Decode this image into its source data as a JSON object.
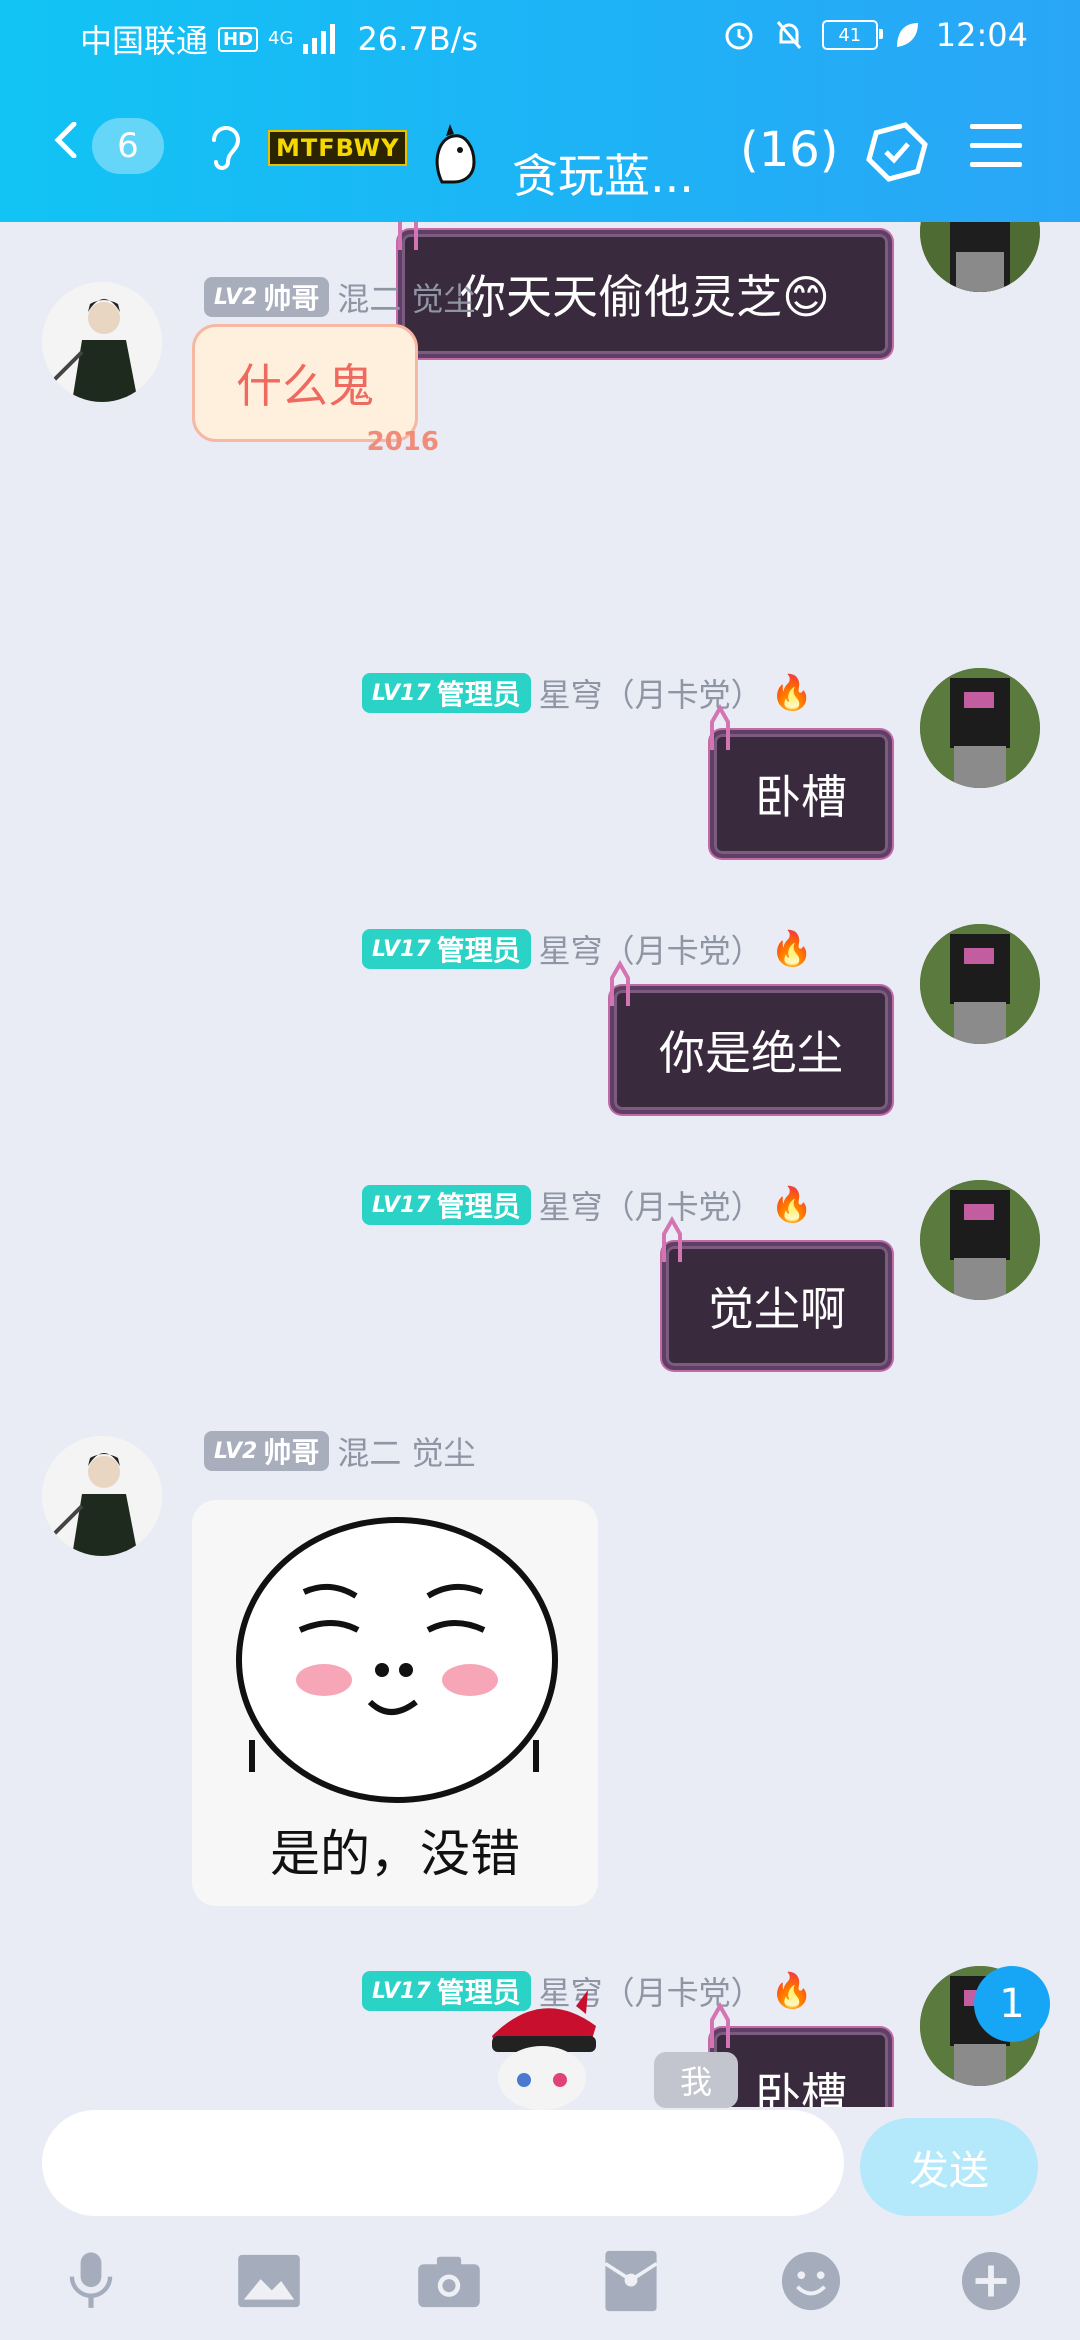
{
  "status_bar": {
    "carrier": "中国联通",
    "hd": "HD",
    "network": "4G",
    "speed": "26.7B/s",
    "battery": "41",
    "time": "12:04"
  },
  "header": {
    "unread_count": "6",
    "badge_text": "MTFBWY",
    "group_name": "贪玩蓝...",
    "member_count": "(16)"
  },
  "messages": [
    {
      "side": "right",
      "text": "你天天偷他灵芝😊",
      "style": "dark"
    },
    {
      "side": "left",
      "level": "LV2",
      "title": "帅哥",
      "name": "混二 觉尘",
      "text": "什么鬼",
      "style": "light",
      "bubble_tag": "2016"
    },
    {
      "side": "right",
      "level": "LV17",
      "title": "管理员",
      "name": "星穹（月卡党）",
      "text": "卧槽",
      "style": "dark"
    },
    {
      "side": "right",
      "level": "LV17",
      "title": "管理员",
      "name": "星穹（月卡党）",
      "text": "你是绝尘",
      "style": "dark"
    },
    {
      "side": "right",
      "level": "LV17",
      "title": "管理员",
      "name": "星穹（月卡党）",
      "text": "觉尘啊",
      "style": "dark"
    },
    {
      "side": "left",
      "level": "LV2",
      "title": "帅哥",
      "name": "混二 觉尘",
      "sticker_caption": "是的，没错",
      "style": "sticker"
    },
    {
      "side": "right",
      "level": "LV17",
      "title": "管理员",
      "name": "星穹（月卡党）",
      "text": "卧槽",
      "style": "dark"
    }
  ],
  "new_message_badge": "1",
  "me_chip": "我",
  "input": {
    "placeholder": "",
    "value": ""
  },
  "send_label": "发送",
  "toolbar": [
    "mic-icon",
    "image-icon",
    "camera-icon",
    "red-packet-icon",
    "emoji-icon",
    "plus-icon"
  ],
  "colors": {
    "header": "#11c4f4",
    "admin_badge": "#2bd3c7",
    "level_badge": "#a9aebd",
    "send_button": "#b3e9fb",
    "chat_background": "#e9ecf5"
  }
}
